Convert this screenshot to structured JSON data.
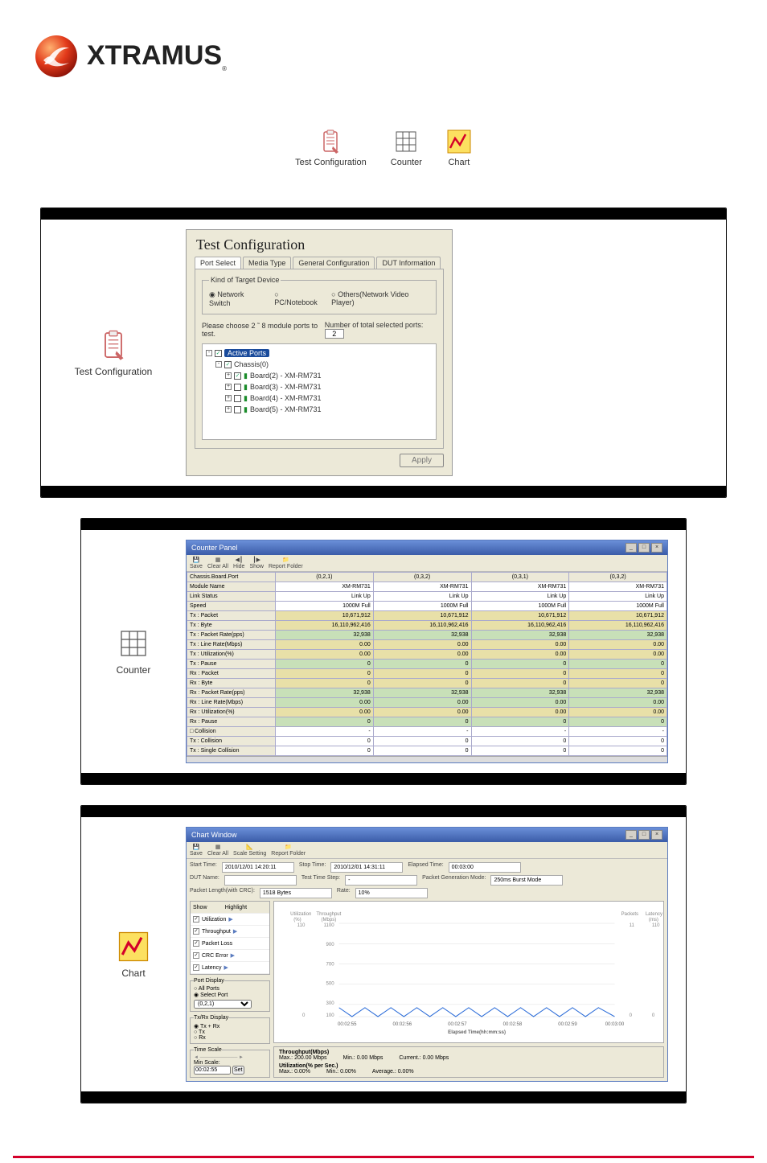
{
  "logo": {
    "text": "XTRAMUS",
    "sub": "®"
  },
  "top_icons": [
    {
      "label": "Test Configuration",
      "name": "test-config-icon"
    },
    {
      "label": "Counter",
      "name": "counter-icon"
    },
    {
      "label": "Chart",
      "name": "chart-icon"
    }
  ],
  "test_config": {
    "title": "Test Configuration",
    "tabs": [
      "Port Select",
      "Media Type",
      "General Configuration",
      "DUT Information"
    ],
    "target_legend": "Kind of Target Device",
    "targets": [
      "Network Switch",
      "PC/Notebook",
      "Others(Network Video Player)"
    ],
    "port_instr": "Please choose 2 ˜ 8 module ports to test.",
    "port_count_label": "Number of total selected ports:",
    "port_count": "2",
    "tree": {
      "root": "Active Ports",
      "chassis": "Chassis(0)",
      "boards": [
        "Board(2) - XM-RM731",
        "Board(3) - XM-RM731",
        "Board(4) - XM-RM731",
        "Board(5) - XM-RM731"
      ]
    },
    "apply": "Apply"
  },
  "counter": {
    "title": "Counter Panel",
    "toolbar": [
      "Save",
      "Clear All",
      "Hide",
      "Show",
      "Report Folder"
    ],
    "headers": [
      "Chassis.Board.Port",
      "(0,2,1)",
      "(0,3,2)",
      "(0,3,1)",
      "(0,3,2)"
    ],
    "rows": [
      {
        "label": "Module Name",
        "v": [
          "XM-RM731",
          "XM-RM731",
          "XM-RM731",
          "XM-RM731"
        ]
      },
      {
        "label": "Link Status",
        "v": [
          "Link Up",
          "Link Up",
          "Link Up",
          "Link Up"
        ]
      },
      {
        "label": "Speed",
        "v": [
          "1000M Full",
          "1000M Full",
          "1000M Full",
          "1000M Full"
        ]
      },
      {
        "label": "Tx : Packet",
        "hl": true,
        "v": [
          "10,671,912",
          "10,671,912",
          "10,671,912",
          "10,671,912"
        ]
      },
      {
        "label": "Tx : Byte",
        "hl": true,
        "v": [
          "16,110,962,416",
          "16,110,962,416",
          "16,110,962,416",
          "16,110,962,416"
        ]
      },
      {
        "label": "Tx : Packet Rate(pps)",
        "hl": true,
        "g": true,
        "v": [
          "32,938",
          "32,938",
          "32,938",
          "32,938"
        ]
      },
      {
        "label": "Tx : Line Rate(Mbps)",
        "hl": true,
        "v": [
          "0.00",
          "0.00",
          "0.00",
          "0.00"
        ]
      },
      {
        "label": "Tx : Utilization(%)",
        "hl": true,
        "v": [
          "0.00",
          "0.00",
          "0.00",
          "0.00"
        ]
      },
      {
        "label": "Tx : Pause",
        "hl": true,
        "g": true,
        "v": [
          "0",
          "0",
          "0",
          "0"
        ]
      },
      {
        "label": "Rx : Packet",
        "hl": true,
        "v": [
          "0",
          "0",
          "0",
          "0"
        ]
      },
      {
        "label": "Rx : Byte",
        "hl": true,
        "v": [
          "0",
          "0",
          "0",
          "0"
        ]
      },
      {
        "label": "Rx : Packet Rate(pps)",
        "hl": true,
        "g": true,
        "v": [
          "32,938",
          "32,938",
          "32,938",
          "32,938"
        ]
      },
      {
        "label": "Rx : Line Rate(Mbps)",
        "hl": true,
        "g": true,
        "v": [
          "0.00",
          "0.00",
          "0.00",
          "0.00"
        ]
      },
      {
        "label": "Rx : Utilization(%)",
        "hl": true,
        "v": [
          "0.00",
          "0.00",
          "0.00",
          "0.00"
        ]
      },
      {
        "label": "Rx : Pause",
        "hl": true,
        "g": true,
        "v": [
          "0",
          "0",
          "0",
          "0"
        ]
      },
      {
        "label": "□ Collision",
        "v": [
          "-",
          "-",
          "-",
          "-"
        ]
      },
      {
        "label": "Tx : Collision",
        "v": [
          "0",
          "0",
          "0",
          "0"
        ]
      },
      {
        "label": "Tx : Single Collision",
        "v": [
          "0",
          "0",
          "0",
          "0"
        ]
      }
    ]
  },
  "chart": {
    "title": "Chart Window",
    "toolbar": [
      "Save",
      "Clear All",
      "Scale Setting",
      "Report Folder"
    ],
    "info": {
      "start_label": "Start Time:",
      "start": "2010/12/01 14:20:11",
      "stop_label": "Stop Time:",
      "stop": "2010/12/01 14:31:11",
      "elapsed_label": "Elapsed Time:",
      "elapsed": "00:03:00",
      "dut_label": "DUT Name:",
      "dut": "",
      "step_label": "Test Time Step:",
      "step": "-",
      "gen_label": "Packet Generation Mode:",
      "gen": "250ms Burst Mode",
      "len_label": "Packet Length(with CRC):",
      "len": "1518 Bytes",
      "rate_label": "Rate:",
      "rate": "10%"
    },
    "showcol": {
      "hdr1": "Show",
      "hdr2": "Highlight",
      "items": [
        "Utilization",
        "Throughput",
        "Packet Loss",
        "CRC Error",
        "Latency"
      ]
    },
    "port_disp": {
      "legend": "Port Display",
      "opts": [
        "All Ports",
        "Select Port"
      ],
      "sel": "(0,2,1)"
    },
    "txrx": {
      "legend": "Tx/Rx Display",
      "opts": [
        "Tx + Rx",
        "Tx",
        "Rx"
      ]
    },
    "timescale": {
      "legend": "Time Scale",
      "min": "Min Scale:",
      "val": "00:02:55",
      "btn": "Set"
    },
    "plot": {
      "y_left_title": "Utilization\n(%)",
      "y_right_title": "Throughput\n(Mbps)",
      "y_pkt_title": "Packets",
      "y_lat_title": "Latency\n(ms)",
      "x_ticks": [
        "00:02:55",
        "00:02:56",
        "00:02:57",
        "00:02:58",
        "00:02:59",
        "00:03:00"
      ],
      "x_label": "Elapsed Time(hh:mm:ss)",
      "legend_t": "Throughput(Mbps)",
      "t_max_l": "Max.:",
      "t_max": "200.00 Mbps",
      "t_min_l": "Min.:",
      "t_min": "0.00 Mbps",
      "t_cur_l": "Current.:",
      "t_cur": "0.00 Mbps",
      "legend_u": "Utilization(% per Sec.)",
      "u_max_l": "Max.:",
      "u_max": "0.00%",
      "u_min_l": "Min.:",
      "u_min": "0.00%",
      "u_avg_l": "Average.:",
      "u_avg": "0.00%"
    }
  },
  "chart_data": {
    "type": "line",
    "x": [
      "00:02:55",
      "00:02:56",
      "00:02:57",
      "00:02:58",
      "00:02:59",
      "00:03:00"
    ],
    "series": [
      {
        "name": "Throughput(Mbps)",
        "values": [
          100,
          0,
          100,
          0,
          100,
          0,
          100,
          0,
          100,
          0,
          100
        ]
      }
    ],
    "xlabel": "Elapsed Time(hh:mm:ss)",
    "ylabel": "Throughput (Mbps)",
    "ylim": [
      0,
      1100
    ]
  }
}
